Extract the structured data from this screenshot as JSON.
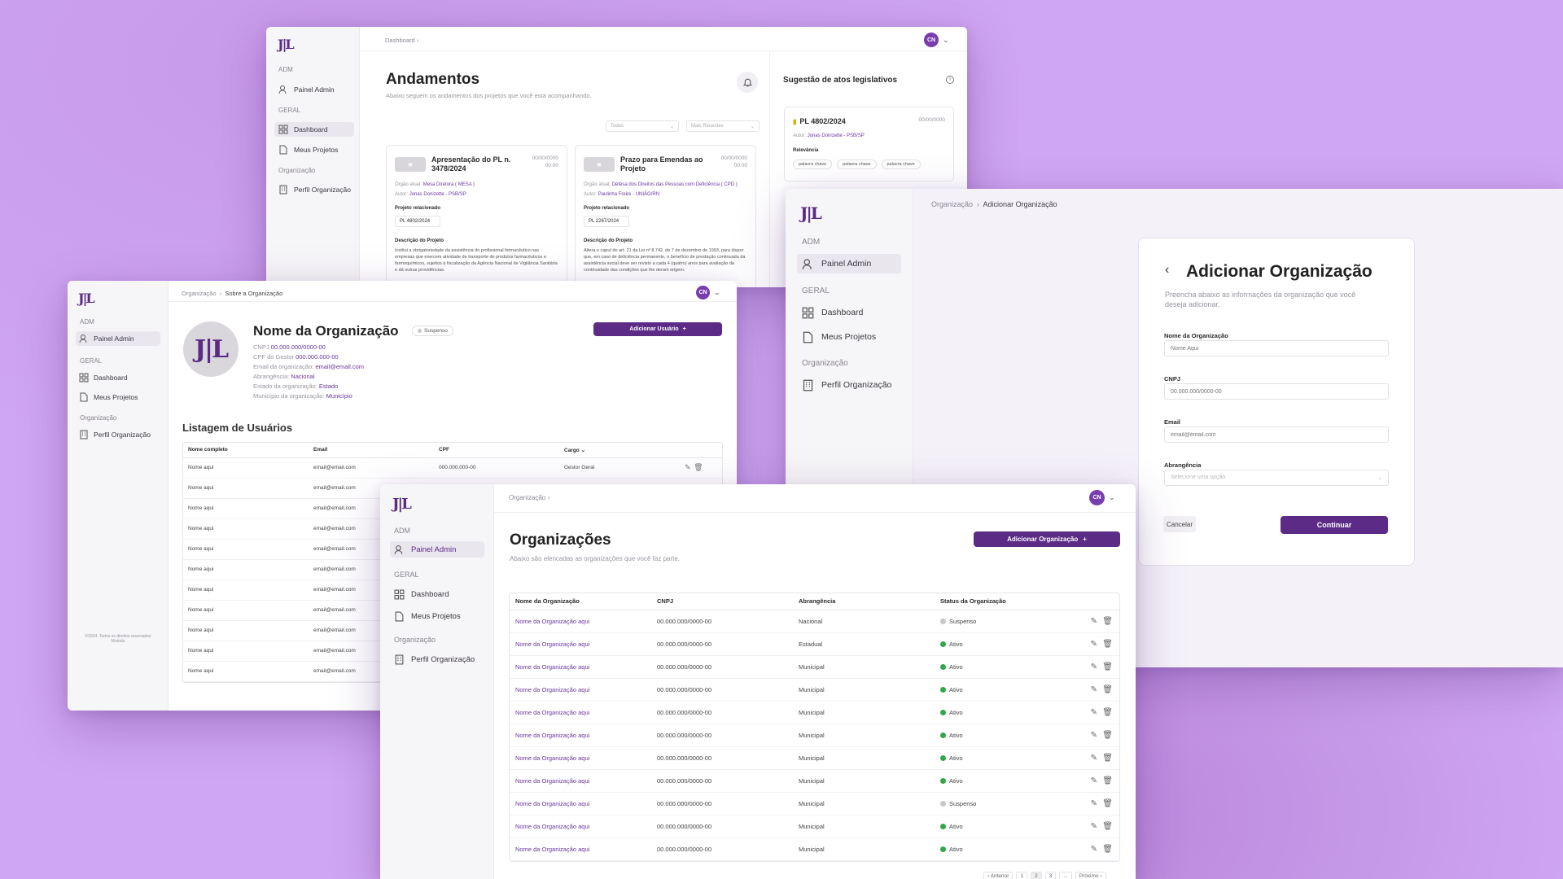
{
  "sidebar": {
    "adm": "ADM",
    "painel": "Painel Admin",
    "geral": "GERAL",
    "dashboard": "Dashboard",
    "projetos": "Meus Projetos",
    "organizacao": "Organização",
    "perfil": "Perfil Organização"
  },
  "avatar": "CN",
  "w1": {
    "crumb": "Dashboard",
    "title": "Andamentos",
    "subtitle": "Abaixo seguem os andamentos dos projetos que você está acompanhando.",
    "filter1": "Todos",
    "filter2": "Mais Recentes",
    "cards": [
      {
        "title": "Apresentação do PL n. 3478/2024",
        "date": "00/00/0000",
        "time": "00:00",
        "orgao_label": "Órgão atual:",
        "orgao": "Mesa Diretora ( MESA )",
        "autor_label": "Autor:",
        "autor": "Jonas Donizette - PSB/SP",
        "proj_label": "Projeto relacionado",
        "proj": "PL 4802/2024",
        "desc_label": "Descrição do Projeto",
        "desc": "Institui a obrigatoriedade da assistência do profissional farmacêutico nas empresas que exercem atividade de transporte de produtos farmacêuticos e farmoquímicos, sujeitos à fiscalização da Agência Nacional de Vigilância Sanitária e dá outras providências."
      },
      {
        "title": "Prazo para Emendas ao Projeto",
        "date": "00/00/0000",
        "time": "00:00",
        "orgao_label": "Órgão atual:",
        "orgao": "Defesa dos Direitos das Pessoas com Deficiência ( CPD )",
        "autor_label": "Autor:",
        "autor": "Paulinha Freire - UNIÃO/RN",
        "proj_label": "Projeto relacionado",
        "proj": "PL 2267/2024",
        "desc_label": "Descrição do Projeto",
        "desc": "Altera o caput do art. 21 da Lei nº 8.742, de 7 de dezembro de 1993, para dispor que, em caso de deficiência permanente, o benefício de prestação continuada da assistência social deve ser revisto a cada 4 (quatro) anos para avaliação da continuidade das condições que lhe deram origem."
      }
    ],
    "side_title": "Sugestão de atos legislativos",
    "sug": {
      "pl": "PL 4802/2024",
      "date": "00/00/0000",
      "autor_label": "Autor:",
      "autor": "Jonas Donizette - PSB/SP",
      "rel": "Relevância",
      "tags": [
        "palavra chave",
        "palavra chave",
        "palavra chave"
      ]
    }
  },
  "w2": {
    "crumb1": "Organização",
    "crumb2": "Sobre a Organização",
    "name": "Nome da Organização",
    "status": "Suspenso",
    "btn": "Adicionar Usuário",
    "fields": [
      {
        "label": "CNPJ",
        "value": "00.000.000/0000-00"
      },
      {
        "label": "CPF do Gestor",
        "value": "000.000.000-00"
      },
      {
        "label": "Email da organização:",
        "value": "email@email.com"
      },
      {
        "label": "Abrangência:",
        "value": "Nacional"
      },
      {
        "label": "Estado da organização:",
        "value": "Estado"
      },
      {
        "label": "Município da organização:",
        "value": "Município"
      }
    ],
    "list_title": "Listagem de Usuários",
    "cols": [
      "Nome completo",
      "Email",
      "CPF",
      "Cargo"
    ],
    "rows": [
      [
        "Nome aqui",
        "email@email.com",
        "000.000.000-00",
        "Gestor Geral"
      ],
      [
        "Nome aqui",
        "email@email.com",
        "",
        ""
      ],
      [
        "Nome aqui",
        "email@email.com",
        "",
        ""
      ],
      [
        "Nome aqui",
        "email@email.com",
        "",
        ""
      ],
      [
        "Nome aqui",
        "email@email.com",
        "",
        ""
      ],
      [
        "Nome aqui",
        "email@email.com",
        "",
        ""
      ],
      [
        "Nome aqui",
        "email@email.com",
        "",
        ""
      ],
      [
        "Nome aqui",
        "email@email.com",
        "",
        ""
      ],
      [
        "Nome aqui",
        "email@email.com",
        "",
        ""
      ],
      [
        "Nome aqui",
        "email@email.com",
        "",
        ""
      ],
      [
        "Nome aqui",
        "email@email.com",
        "",
        ""
      ]
    ],
    "footer": "©2024. Todos os direitos reservados Motoda"
  },
  "w3": {
    "crumb1": "Organização",
    "crumb2": "Adicionar Organização",
    "title": "Adicionar Organização",
    "subtitle": "Preencha abaixo as informações da organização que você deseja adicionar.",
    "fields": [
      {
        "label": "Nome da Organização",
        "placeholder": "Nome Aqui"
      },
      {
        "label": "CNPJ",
        "placeholder": "00.000.000/0000-00"
      },
      {
        "label": "Email",
        "placeholder": "email@email.com"
      },
      {
        "label": "Abrangência",
        "placeholder": "Selecione uma opção"
      }
    ],
    "cancel": "Cancelar",
    "continue": "Continuar"
  },
  "w4": {
    "crumb": "Organização",
    "title": "Organizações",
    "subtitle": "Abaixo são elencadas as organizações que você faz parte.",
    "btn": "Adicionar Organização",
    "cols": [
      "Nome da Organização",
      "CNPJ",
      "Abrangência",
      "Status da Organização"
    ],
    "rows": [
      {
        "name": "Nome da Organização aqui",
        "cnpj": "00.000.000/0000-00",
        "abr": "Nacional",
        "status": "Suspenso",
        "color": "#c9c6cc"
      },
      {
        "name": "Nome da Organização aqui",
        "cnpj": "00.000.000/0000-00",
        "abr": "Estadual",
        "status": "Ativo",
        "color": "#2ea84a"
      },
      {
        "name": "Nome da Organização aqui",
        "cnpj": "00.000.000/0000-00",
        "abr": "Municipal",
        "status": "Ativo",
        "color": "#2ea84a"
      },
      {
        "name": "Nome da Organização aqui",
        "cnpj": "00.000.000/0000-00",
        "abr": "Municipal",
        "status": "Ativo",
        "color": "#2ea84a"
      },
      {
        "name": "Nome da Organização aqui",
        "cnpj": "00.000.000/0000-00",
        "abr": "Municipal",
        "status": "Ativo",
        "color": "#2ea84a"
      },
      {
        "name": "Nome da Organização aqui",
        "cnpj": "00.000.000/0000-00",
        "abr": "Municipal",
        "status": "Ativo",
        "color": "#2ea84a"
      },
      {
        "name": "Nome da Organização aqui",
        "cnpj": "00.000.000/0000-00",
        "abr": "Municipal",
        "status": "Ativo",
        "color": "#2ea84a"
      },
      {
        "name": "Nome da Organização aqui",
        "cnpj": "00.000.000/0000-00",
        "abr": "Municipal",
        "status": "Ativo",
        "color": "#2ea84a"
      },
      {
        "name": "Nome da Organização aqui",
        "cnpj": "00.000.000/0000-00",
        "abr": "Municipal",
        "status": "Suspenso",
        "color": "#c9c6cc"
      },
      {
        "name": "Nome da Organização aqui",
        "cnpj": "00.000.000/0000-00",
        "abr": "Municipal",
        "status": "Ativo",
        "color": "#2ea84a"
      },
      {
        "name": "Nome da Organização aqui",
        "cnpj": "00.000.000/0000-00",
        "abr": "Municipal",
        "status": "Ativo",
        "color": "#2ea84a"
      }
    ],
    "pager": {
      "prev": "Anterior",
      "pages": [
        "1",
        "2",
        "3",
        "..."
      ],
      "next": "Próximo"
    }
  }
}
